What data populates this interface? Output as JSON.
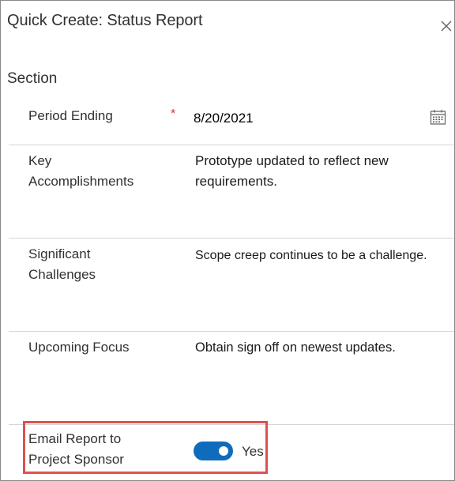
{
  "header": {
    "title": "Quick Create: Status Report",
    "close_icon": "close-icon"
  },
  "section": {
    "title": "Section"
  },
  "fields": {
    "period_ending": {
      "label": "Period Ending",
      "required_marker": "*",
      "value": "8/20/2021",
      "icon": "calendar-icon"
    },
    "key_accomplishments": {
      "label_line1": "Key",
      "label_line2": "Accomplishments",
      "value_line1": "Prototype updated to reflect new",
      "value_line2": "requirements."
    },
    "significant_challenges": {
      "label_line1": "Significant",
      "label_line2": "Challenges",
      "value": "Scope creep continues to be a challenge."
    },
    "upcoming_focus": {
      "label": "Upcoming Focus",
      "value": "Obtain sign off on newest updates."
    },
    "email_report": {
      "label_line1": "Email Report to",
      "label_line2": "Project Sponsor",
      "toggle_state": true,
      "toggle_text": "Yes",
      "toggle_color": "#0f6cbd",
      "highlight_color": "#d9534f"
    }
  },
  "colors": {
    "required": "#d13438",
    "divider": "#d6d6d6"
  }
}
